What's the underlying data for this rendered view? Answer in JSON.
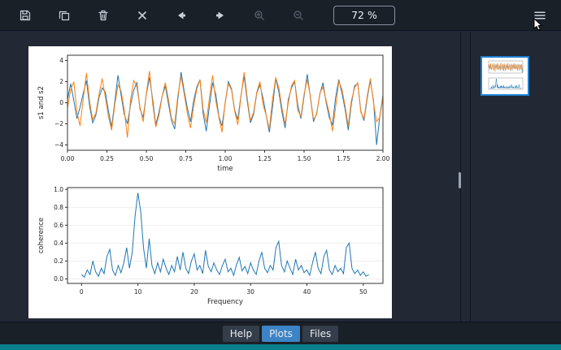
{
  "toolbar": {
    "zoom_level": "72 %",
    "icons": [
      "save-icon",
      "copy-icon",
      "delete-icon",
      "close-icon",
      "previous-plot-icon",
      "next-plot-icon",
      "zoom-in-icon",
      "zoom-out-icon",
      "menu-icon"
    ]
  },
  "tabs": {
    "active": "Plots",
    "items": [
      {
        "label": "Help"
      },
      {
        "label": "Plots"
      },
      {
        "label": "Files"
      }
    ]
  },
  "sidebar": {
    "thumbnails": [
      {
        "selected": true
      }
    ]
  },
  "colors": {
    "accent": "#3d84c6",
    "status_bar": "#0b7f8d",
    "thumbnail_border": "#1f7fd1",
    "series_blue": "#1f77b4",
    "series_orange": "#ff7f0e"
  },
  "chart_data": [
    {
      "type": "line",
      "title": "",
      "xlabel": "time",
      "ylabel": "s1 and s2",
      "xlim": [
        0,
        2
      ],
      "ylim": [
        -4.5,
        4.5
      ],
      "xticks": [
        0,
        0.25,
        0.5,
        0.75,
        1,
        1.25,
        1.5,
        1.75,
        2
      ],
      "xtick_labels": [
        "0.00",
        "0.25",
        "0.50",
        "0.75",
        "1.00",
        "1.25",
        "1.50",
        "1.75",
        "2.00"
      ],
      "yticks": [
        -4,
        -2,
        0,
        2,
        4
      ],
      "ytick_labels": [
        "−4",
        "−2",
        "0",
        "2",
        "4"
      ],
      "grid": false,
      "x_start": 0,
      "x_step": 0.02,
      "series": [
        {
          "name": "s1",
          "color": "#1f77b4",
          "values": [
            0.3,
            1.8,
            0.2,
            -1.5,
            -0.4,
            0.9,
            2.1,
            -0.3,
            -1.9,
            -1.2,
            0.5,
            1.4,
            1.0,
            -0.8,
            -2.3,
            0.1,
            2.6,
            0.7,
            -1.1,
            -2.0,
            -0.2,
            1.2,
            1.9,
            -0.6,
            -1.4,
            0.8,
            2.4,
            0.3,
            -2.1,
            -0.9,
            0.6,
            1.6,
            -0.1,
            -1.7,
            -2.5,
            0.4,
            2.9,
            1.1,
            -0.5,
            -1.8,
            0.2,
            1.5,
            2.2,
            -1.0,
            -2.7,
            -0.3,
            1.9,
            0.8,
            -1.3,
            -2.2,
            0.0,
            2.0,
            1.3,
            -0.7,
            -1.6,
            0.7,
            2.5,
            0.1,
            -1.9,
            -1.1,
            0.9,
            1.7,
            0.4,
            -1.2,
            -2.8,
            -0.4,
            2.3,
            1.0,
            -0.9,
            -2.4,
            0.3,
            1.4,
            2.0,
            -0.2,
            -1.5,
            0.6,
            2.7,
            0.5,
            -1.8,
            -1.0,
            0.8,
            1.9,
            0.0,
            -1.4,
            -2.1,
            0.5,
            2.2,
            0.9,
            -0.6,
            -2.6,
            -0.1,
            1.6,
            1.8,
            -0.8,
            -1.7,
            0.4,
            2.1,
            0.2,
            -4.0,
            -1.3,
            0.7
          ]
        },
        {
          "name": "s2",
          "color": "#ff7f0e",
          "values": [
            -0.5,
            1.2,
            2.0,
            -0.9,
            -2.2,
            0.4,
            2.8,
            0.1,
            -1.6,
            -1.0,
            0.8,
            2.3,
            0.5,
            -1.3,
            -2.6,
            -0.2,
            1.7,
            1.1,
            -0.7,
            -3.3,
            0.3,
            2.1,
            1.5,
            -0.4,
            -1.8,
            0.9,
            3.0,
            -0.1,
            -2.3,
            -1.2,
            0.6,
            1.9,
            0.3,
            -1.5,
            -2.0,
            0.7,
            2.5,
            0.8,
            -1.0,
            -2.4,
            -0.3,
            1.3,
            2.2,
            -0.6,
            -1.9,
            0.5,
            2.6,
            0.2,
            -1.4,
            -2.8,
            0.1,
            1.8,
            1.2,
            -0.8,
            -2.1,
            0.6,
            2.9,
            0.4,
            -1.7,
            -0.9,
            1.0,
            2.0,
            -0.2,
            -1.2,
            -2.5,
            0.3,
            2.4,
            1.4,
            -0.5,
            -2.0,
            0.0,
            1.6,
            2.1,
            -0.7,
            -1.3,
            0.8,
            2.2,
            0.6,
            -1.6,
            -1.1,
            0.9,
            1.5,
            0.2,
            -1.0,
            -2.7,
            -0.4,
            2.0,
            1.3,
            -0.3,
            -2.2,
            0.2,
            1.4,
            1.9,
            -0.9,
            -1.5,
            0.6,
            2.3,
            0.0,
            -1.8,
            -1.4,
            0.5
          ]
        }
      ]
    },
    {
      "type": "line",
      "title": "",
      "xlabel": "Frequency",
      "ylabel": "coherence",
      "xlim": [
        -2.5,
        53.5
      ],
      "ylim": [
        -0.05,
        1.02
      ],
      "xticks": [
        0,
        10,
        20,
        30,
        40,
        50
      ],
      "xtick_labels": [
        "0",
        "10",
        "20",
        "30",
        "40",
        "50"
      ],
      "yticks": [
        0,
        0.2,
        0.4,
        0.6,
        0.8,
        1.0
      ],
      "ytick_labels": [
        "0.0",
        "0.2",
        "0.4",
        "0.6",
        "0.8",
        "1.0"
      ],
      "grid": true,
      "x_start": 0,
      "x_step": 0.5,
      "series": [
        {
          "name": "coherence",
          "color": "#1f77b4",
          "values": [
            0.05,
            0.02,
            0.1,
            0.05,
            0.2,
            0.08,
            0.03,
            0.12,
            0.06,
            0.25,
            0.33,
            0.1,
            0.04,
            0.15,
            0.07,
            0.18,
            0.35,
            0.12,
            0.3,
            0.7,
            0.96,
            0.75,
            0.35,
            0.12,
            0.45,
            0.15,
            0.06,
            0.18,
            0.08,
            0.22,
            0.12,
            0.05,
            0.15,
            0.08,
            0.25,
            0.1,
            0.3,
            0.12,
            0.06,
            0.2,
            0.28,
            0.1,
            0.15,
            0.06,
            0.32,
            0.14,
            0.08,
            0.18,
            0.1,
            0.05,
            0.15,
            0.22,
            0.08,
            0.12,
            0.04,
            0.16,
            0.24,
            0.09,
            0.14,
            0.06,
            0.18,
            0.1,
            0.05,
            0.2,
            0.3,
            0.12,
            0.07,
            0.15,
            0.1,
            0.35,
            0.42,
            0.15,
            0.08,
            0.2,
            0.12,
            0.05,
            0.22,
            0.1,
            0.15,
            0.07,
            0.1,
            0.04,
            0.18,
            0.3,
            0.12,
            0.06,
            0.25,
            0.32,
            0.1,
            0.05,
            0.15,
            0.08,
            0.12,
            0.06,
            0.35,
            0.4,
            0.12,
            0.06,
            0.1,
            0.04,
            0.08,
            0.03,
            0.05
          ]
        }
      ]
    }
  ]
}
